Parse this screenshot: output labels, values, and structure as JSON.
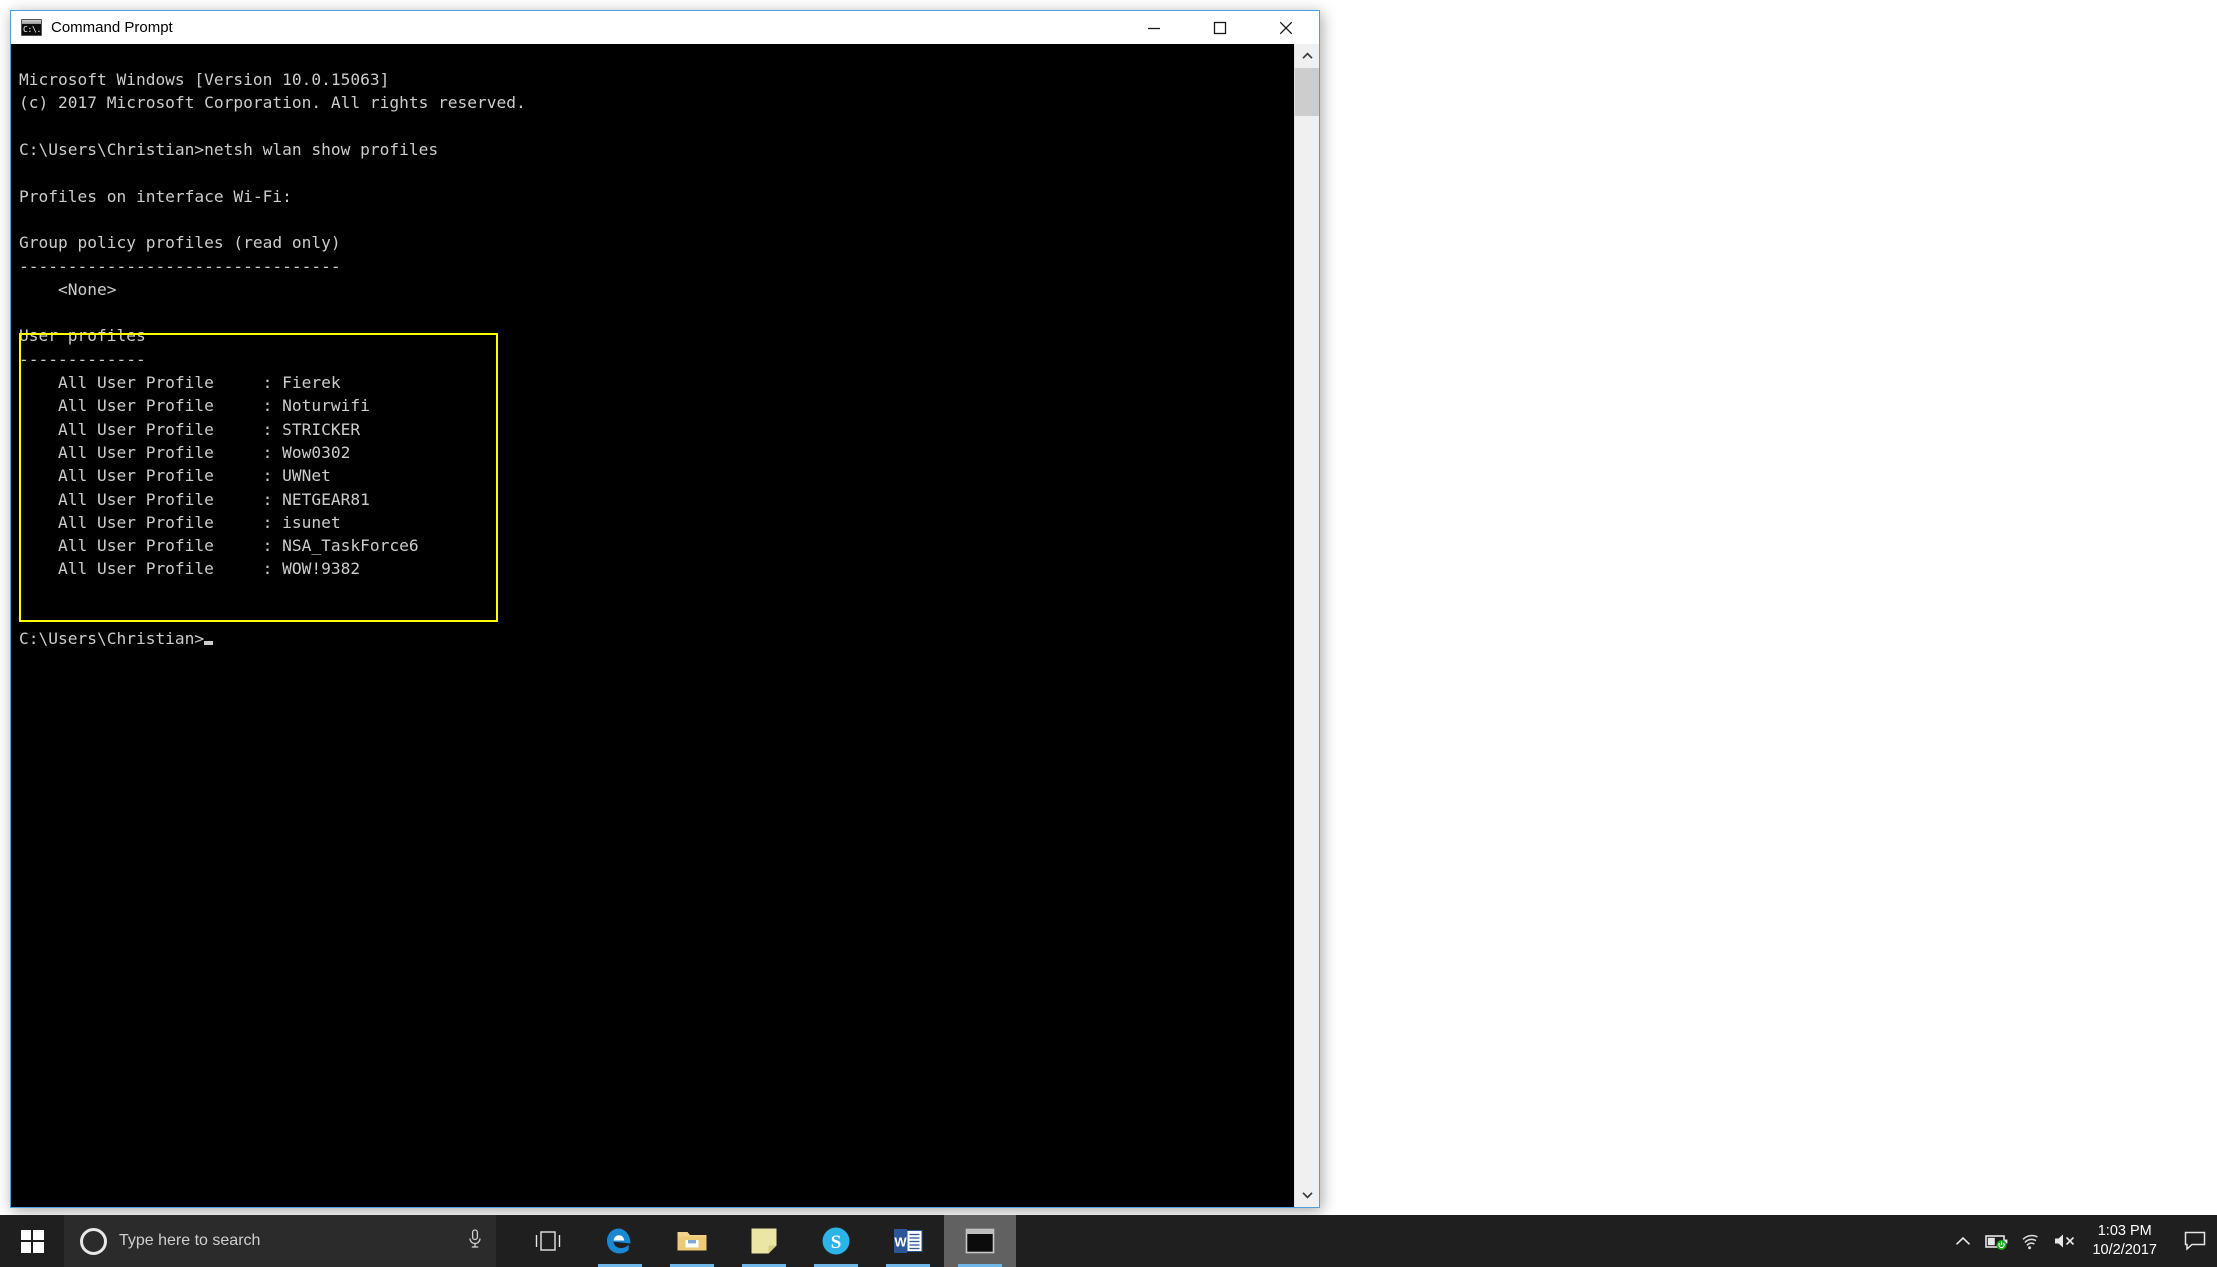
{
  "window": {
    "title": "Command Prompt",
    "icon": "cmd-icon",
    "buttons": {
      "minimize": "minimize-button",
      "maximize": "maximize-button",
      "close": "close-button"
    }
  },
  "console": {
    "lines": [
      "Microsoft Windows [Version 10.0.15063]",
      "(c) 2017 Microsoft Corporation. All rights reserved.",
      "",
      "C:\\Users\\Christian>netsh wlan show profiles",
      "",
      "Profiles on interface Wi-Fi:",
      "",
      "Group policy profiles (read only)",
      "---------------------------------",
      "    <None>",
      "",
      "User profiles",
      "-------------",
      "    All User Profile     : Fierek",
      "    All User Profile     : Noturwifi",
      "    All User Profile     : STRICKER",
      "    All User Profile     : Wow0302",
      "    All User Profile     : UWNet",
      "    All User Profile     : NETGEAR81",
      "    All User Profile     : isunet",
      "    All User Profile     : NSA_TaskForce6",
      "    All User Profile     : WOW!9382",
      "",
      ""
    ],
    "prompt": "C:\\Users\\Christian>",
    "command_entered": "netsh wlan show profiles",
    "os_version": "Microsoft Windows [Version 10.0.15063]",
    "copyright": "(c) 2017 Microsoft Corporation. All rights reserved.",
    "interface": "Wi-Fi",
    "group_policy_profiles": [
      "<None>"
    ],
    "user_profiles": [
      "Fierek",
      "Noturwifi",
      "STRICKER",
      "Wow0302",
      "UWNet",
      "NETGEAR81",
      "isunet",
      "NSA_TaskForce6",
      "WOW!9382"
    ],
    "highlight_color": "#ffff00",
    "text_color": "#cccccc",
    "background_color": "#000000"
  },
  "taskbar": {
    "search_placeholder": "Type here to search",
    "items": [
      {
        "name": "task-view",
        "label": "Task View"
      },
      {
        "name": "microsoft-edge",
        "label": "Microsoft Edge"
      },
      {
        "name": "file-explorer",
        "label": "File Explorer"
      },
      {
        "name": "sticky-notes",
        "label": "Sticky Notes"
      },
      {
        "name": "skype",
        "label": "Skype"
      },
      {
        "name": "microsoft-word",
        "label": "Microsoft Word"
      },
      {
        "name": "command-prompt",
        "label": "Command Prompt"
      }
    ],
    "tray": {
      "show_hidden": "^",
      "battery": "battery-icon",
      "network": "wifi-icon",
      "volume": "volume-muted-icon",
      "time": "1:03 PM",
      "date": "10/2/2017",
      "action_center": "action-center-icon"
    }
  }
}
